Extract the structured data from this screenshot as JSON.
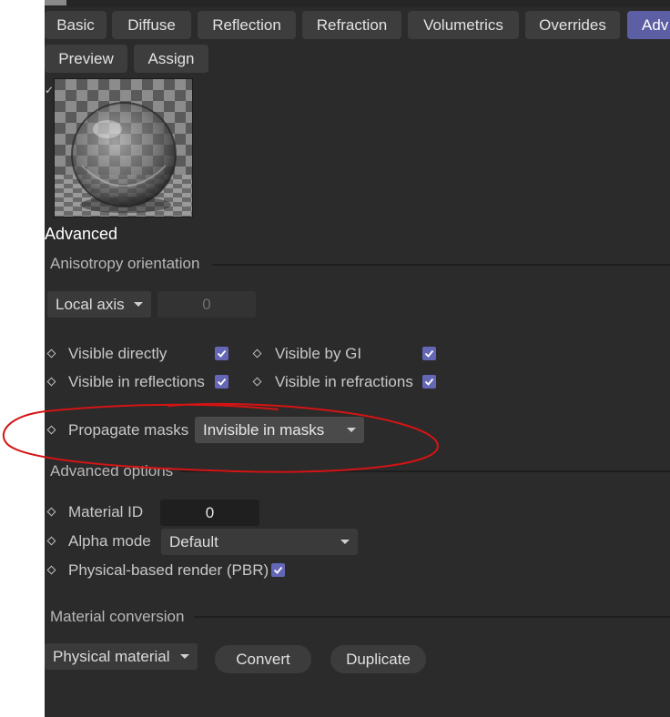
{
  "tabs": [
    {
      "label": "Basic"
    },
    {
      "label": "Diffuse"
    },
    {
      "label": "Reflection"
    },
    {
      "label": "Refraction"
    },
    {
      "label": "Volumetrics"
    },
    {
      "label": "Overrides"
    },
    {
      "label": "Adv"
    }
  ],
  "actions": {
    "preview_label": "Preview",
    "assign_label": "Assign"
  },
  "page_title": "Advanced",
  "anisotropy": {
    "section_label": "Anisotropy orientation",
    "axis_value": "Local axis",
    "angle_value": "0"
  },
  "visibility": {
    "visible_directly": "Visible directly",
    "visible_by_gi": "Visible by GI",
    "visible_in_reflections": "Visible in reflections",
    "visible_in_refractions": "Visible in refractions",
    "propagate_masks_label": "Propagate masks",
    "propagate_masks_value": "Invisible in masks"
  },
  "advanced_options": {
    "section_label": "Advanced options",
    "material_id_label": "Material ID",
    "material_id_value": "0",
    "alpha_mode_label": "Alpha mode",
    "alpha_mode_value": "Default",
    "pbr_label": "Physical-based render (PBR)"
  },
  "conversion": {
    "section_label": "Material conversion",
    "type_value": "Physical material",
    "convert_label": "Convert",
    "duplicate_label": "Duplicate"
  },
  "colors": {
    "panel_bg": "#2b2b2b",
    "accent": "#5c5fa3",
    "checkbox": "#6466b6",
    "annotation": "#d41414"
  },
  "icons": [
    "checkmark-icon",
    "diamond-icon",
    "dropdown-arrow-icon"
  ]
}
